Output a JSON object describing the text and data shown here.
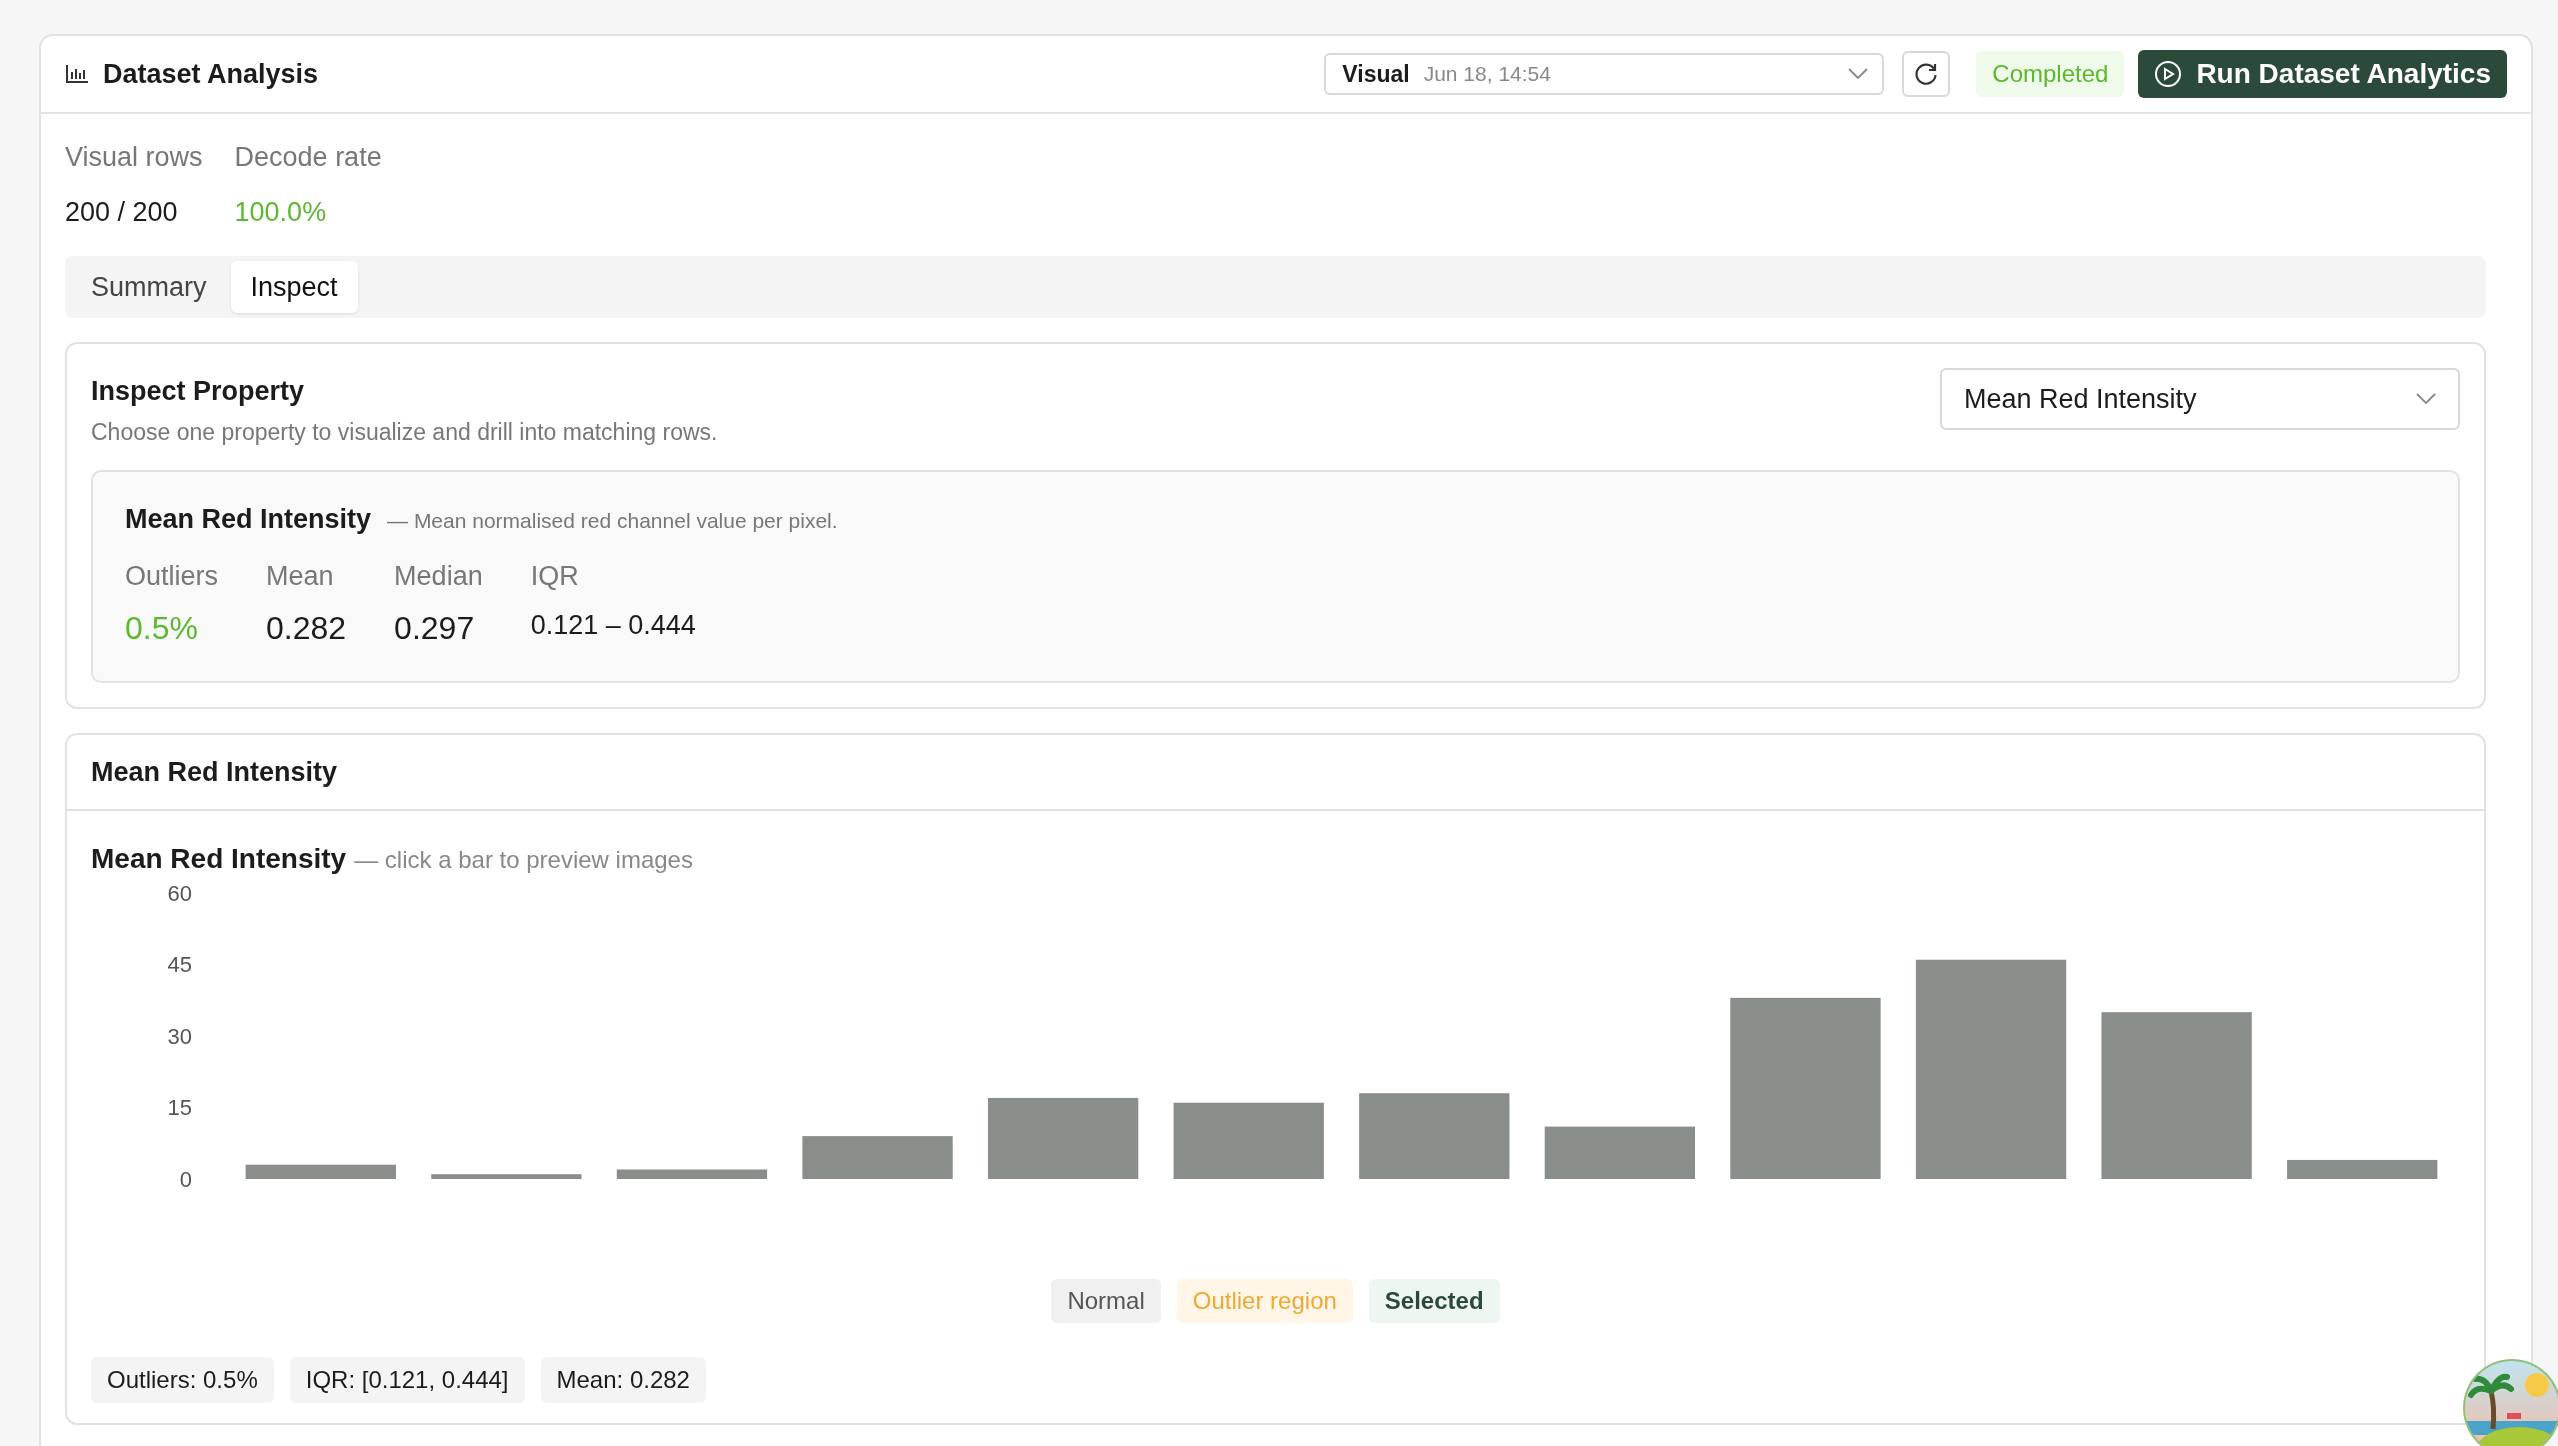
{
  "header": {
    "title": "Dataset Analysis",
    "run_select": {
      "label": "Visual",
      "timestamp": "Jun 18, 14:54"
    },
    "status": "Completed",
    "run_button": "Run Dataset Analytics"
  },
  "stats": [
    {
      "label": "Visual rows",
      "value": "200 / 200",
      "kind": "plain"
    },
    {
      "label": "Decode rate",
      "value": "100.0%",
      "kind": "good"
    }
  ],
  "tabs": [
    {
      "label": "Summary",
      "selected": false
    },
    {
      "label": "Inspect",
      "selected": true
    }
  ],
  "inspect": {
    "title": "Inspect Property",
    "subtitle": "Choose one property to visualize and drill into matching rows.",
    "property_select": "Mean Red Intensity",
    "property": {
      "name": "Mean Red Intensity",
      "description": "— Mean normalised red channel value per pixel.",
      "metrics": [
        {
          "label": "Outliers",
          "value": "0.5%",
          "kind": "good"
        },
        {
          "label": "Mean",
          "value": "0.282",
          "kind": "plain"
        },
        {
          "label": "Median",
          "value": "0.297",
          "kind": "plain"
        },
        {
          "label": "IQR",
          "value": "0.121 – 0.444",
          "kind": "small"
        }
      ]
    }
  },
  "histogram": {
    "panel_title": "Mean Red Intensity",
    "title": "Mean Red Intensity",
    "hint": "— click a bar to preview images",
    "chart_data": {
      "type": "bar",
      "ylim": [
        0,
        60
      ],
      "yticks": [
        0,
        15,
        30,
        45,
        60
      ],
      "series": [
        {
          "color": "#8a8e8a",
          "values": [
            3,
            1,
            2,
            9,
            17,
            16,
            18,
            11,
            38,
            46,
            35,
            4
          ]
        }
      ]
    },
    "legend": [
      {
        "label": "Normal",
        "kind": "normal"
      },
      {
        "label": "Outlier region",
        "kind": "outlier"
      },
      {
        "label": "Selected",
        "kind": "selected"
      }
    ],
    "pills": [
      "Outliers: 0.5%",
      "IQR: [0.121, 0.444]",
      "Mean: 0.282"
    ]
  }
}
